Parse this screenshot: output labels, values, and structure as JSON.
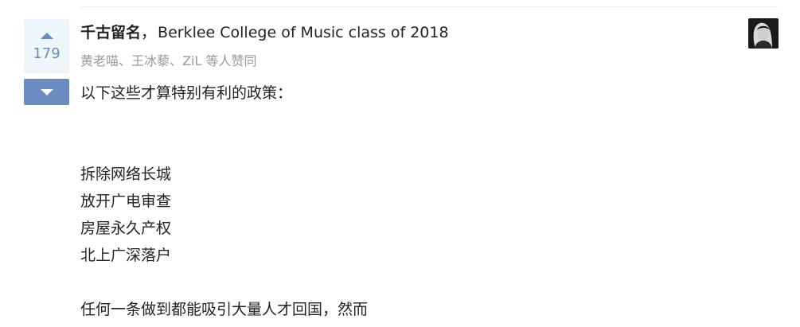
{
  "vote": {
    "count": "179"
  },
  "author": {
    "name": "千古留名",
    "separator": "，",
    "bio": "Berklee College of Music class of 2018"
  },
  "voters": {
    "names": [
      "黄老喵",
      "王冰藜",
      "ZiL"
    ],
    "separator": "、",
    "suffix": " 等人赞同"
  },
  "answer": {
    "intro": "以下这些才算特别有利的政策：",
    "items": [
      "拆除网络长城",
      "放开广电审查",
      "房屋永久产权",
      "北上广深落户"
    ],
    "conclusion": "任何一条做到都能吸引大量人才回国，然而"
  },
  "colors": {
    "accent": "#6b8cc0",
    "upvote_bg": "#eff6fa",
    "meta_text": "#999999",
    "body_text": "#222222"
  }
}
